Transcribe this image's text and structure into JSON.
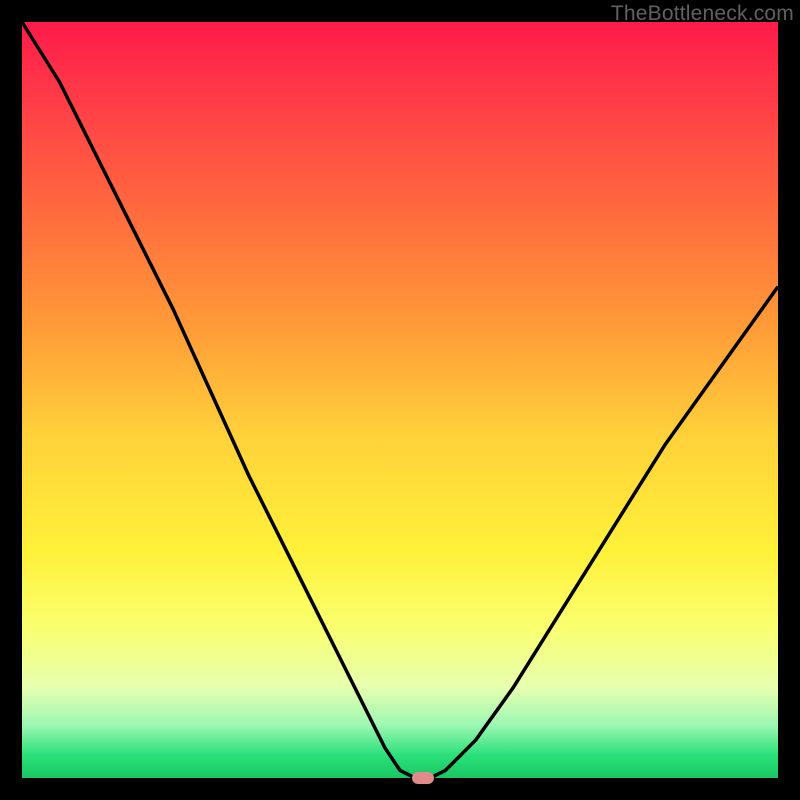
{
  "watermark": "TheBottleneck.com",
  "chart_data": {
    "type": "line",
    "title": "",
    "xlabel": "",
    "ylabel": "",
    "xlim": [
      0,
      100
    ],
    "ylim": [
      0,
      100
    ],
    "x": [
      0,
      5,
      10,
      15,
      20,
      25,
      30,
      35,
      40,
      45,
      48,
      50,
      52,
      54,
      56,
      60,
      65,
      70,
      75,
      80,
      85,
      90,
      95,
      100
    ],
    "values": [
      100,
      92,
      82,
      72,
      62,
      51,
      40,
      30,
      20,
      10,
      4,
      1,
      0,
      0,
      1,
      5,
      12,
      20,
      28,
      36,
      44,
      51,
      58,
      65
    ],
    "marker": {
      "x": 53,
      "y": 0
    },
    "colors": {
      "curve": "#000000",
      "marker": "#e08a8a",
      "gradient_top": "#ff1a4a",
      "gradient_bottom": "#18c762"
    }
  }
}
